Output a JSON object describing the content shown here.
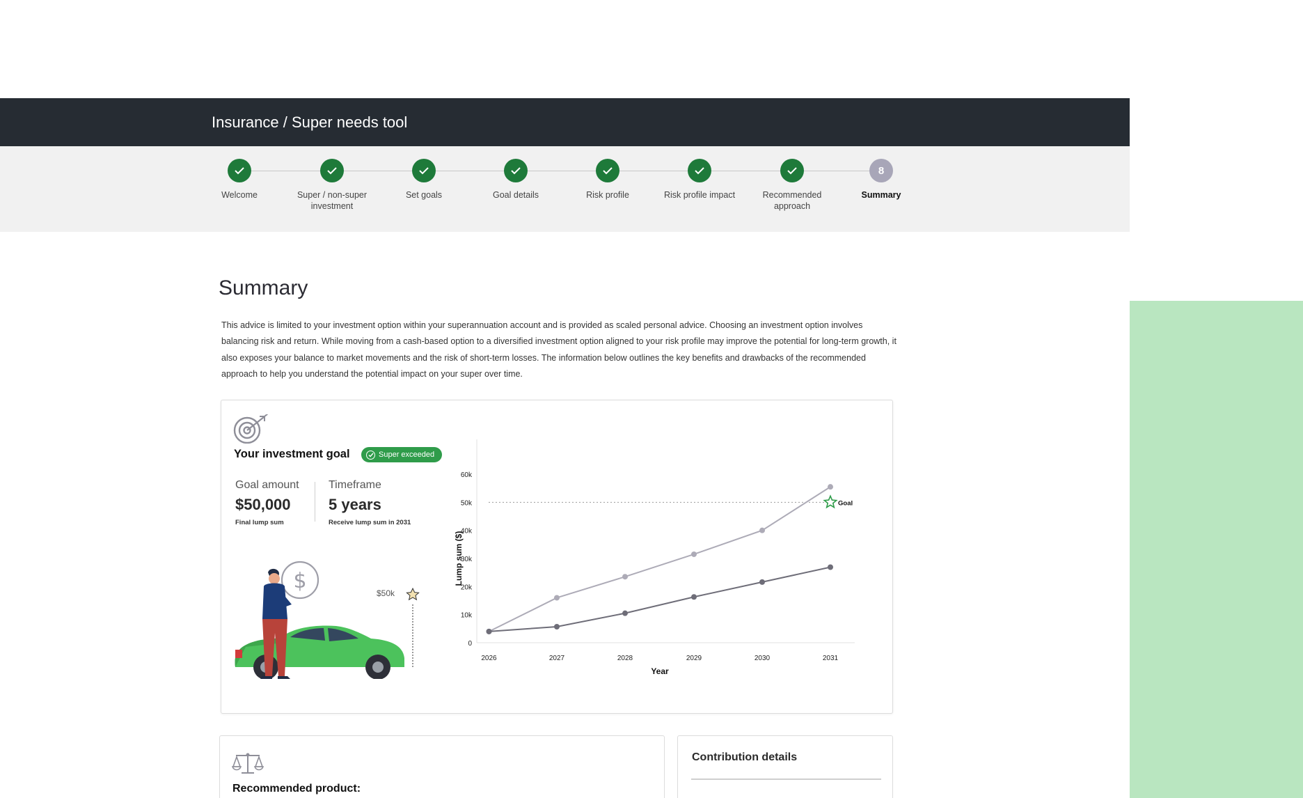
{
  "header": {
    "title": "Insurance / Super needs tool"
  },
  "stepper": {
    "steps": [
      {
        "label": "Welcome",
        "status": "done"
      },
      {
        "label": "Super / non-super investment",
        "status": "done"
      },
      {
        "label": "Set goals",
        "status": "done"
      },
      {
        "label": "Goal details",
        "status": "done"
      },
      {
        "label": "Risk profile",
        "status": "done"
      },
      {
        "label": "Risk profile impact",
        "status": "done"
      },
      {
        "label": "Recommended approach",
        "status": "done"
      },
      {
        "label": "Summary",
        "status": "current",
        "number": "8"
      }
    ]
  },
  "main": {
    "title": "Summary",
    "intro": "This advice is limited to your investment option within your superannuation account and is provided as scaled personal advice. Choosing an investment option involves balancing risk and return. While moving from a cash-based option to a diversified investment option aligned to your risk profile may improve the potential for long-term growth, it also exposes your balance to market movements and the risk of short-term losses. The information below outlines the key benefits and drawbacks of the recommended approach to help you understand the potential impact on your super over time."
  },
  "goal_card": {
    "heading": "Your investment goal",
    "badge": "Super exceeded",
    "goal_amount_label": "Goal amount",
    "goal_amount_value": "$50,000",
    "goal_amount_sub": "Final lump sum",
    "timeframe_label": "Timeframe",
    "timeframe_value": "5 years",
    "timeframe_sub": "Receive lump sum in 2031",
    "illustration_marker": "$50k"
  },
  "chart_data": {
    "type": "line",
    "x": [
      2026,
      2027,
      2028,
      2029,
      2030,
      2031
    ],
    "series": [
      {
        "values": [
          4000,
          16000,
          23500,
          31500,
          40000,
          55500
        ],
        "color": "#adabb7"
      },
      {
        "values": [
          4000,
          5700,
          10500,
          16300,
          21600,
          26900
        ],
        "color": "#6e6d78"
      }
    ],
    "goal": {
      "value": 50000,
      "label": "Goal"
    },
    "xlabel": "Year",
    "ylabel": "Lump sum ($)",
    "ylim": [
      0,
      60000
    ],
    "yticks": [
      "0",
      "10k",
      "20k",
      "30k",
      "40k",
      "50k",
      "60k"
    ],
    "xticks": [
      "2026",
      "2027",
      "2028",
      "2029",
      "2030",
      "2031"
    ],
    "grid": false
  },
  "product_card": {
    "title": "Recommended product:"
  },
  "contribution_card": {
    "title": "Contribution details"
  }
}
